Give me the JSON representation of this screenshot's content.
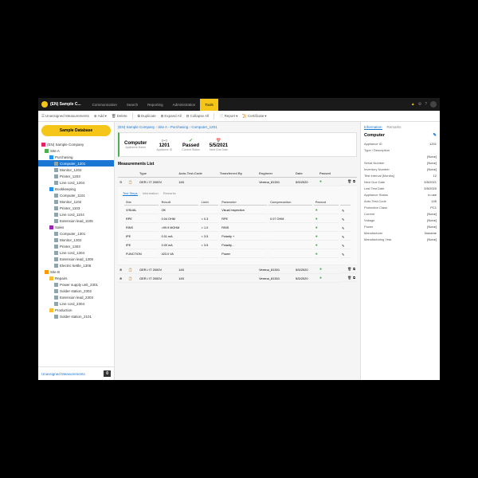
{
  "header": {
    "app_title": "(EN) Sample C...",
    "nav": [
      "Communication",
      "Search",
      "Reporting",
      "Administration",
      "Tools"
    ],
    "active_nav": 4
  },
  "toolbar": {
    "unassigned": "Unassigned Measurements",
    "add": "Add",
    "delete": "Delete",
    "duplicate": "Duplicate",
    "expand": "Expand All",
    "collapse": "Collapse All",
    "report": "Report",
    "certificate": "Certificate"
  },
  "sidebar": {
    "database_btn": "Sample Database",
    "tree": [
      {
        "lvl": 0,
        "ico": "company",
        "label": "(EN) Sample Company"
      },
      {
        "lvl": 1,
        "ico": "dept",
        "label": "Site A"
      },
      {
        "lvl": 2,
        "ico": "dept2",
        "label": "Purchasing"
      },
      {
        "lvl": 3,
        "ico": "device",
        "label": "Computer_1201",
        "sel": true
      },
      {
        "lvl": 3,
        "ico": "device",
        "label": "Monitor_1202"
      },
      {
        "lvl": 3,
        "ico": "device",
        "label": "Printer_1203"
      },
      {
        "lvl": 3,
        "ico": "device",
        "label": "Line cord_1204"
      },
      {
        "lvl": 2,
        "ico": "dept2",
        "label": "Bookkeeping"
      },
      {
        "lvl": 3,
        "ico": "device",
        "label": "Computer_1101"
      },
      {
        "lvl": 3,
        "ico": "device",
        "label": "Monitor_1102"
      },
      {
        "lvl": 3,
        "ico": "device",
        "label": "Printer_1103"
      },
      {
        "lvl": 3,
        "ico": "device",
        "label": "Line cord_1104"
      },
      {
        "lvl": 3,
        "ico": "device",
        "label": "Extension lead_1105"
      },
      {
        "lvl": 2,
        "ico": "dept3",
        "label": "Sales"
      },
      {
        "lvl": 3,
        "ico": "device",
        "label": "Computer_1301"
      },
      {
        "lvl": 3,
        "ico": "device",
        "label": "Monitor_1302"
      },
      {
        "lvl": 3,
        "ico": "device",
        "label": "Printer_1303"
      },
      {
        "lvl": 3,
        "ico": "device",
        "label": "Line cord_1304"
      },
      {
        "lvl": 3,
        "ico": "device",
        "label": "Extension lead_1305"
      },
      {
        "lvl": 3,
        "ico": "device",
        "label": "Electric kettle_1306"
      },
      {
        "lvl": 1,
        "ico": "dept4",
        "label": "Site B"
      },
      {
        "lvl": 2,
        "ico": "folder",
        "label": "Repairs"
      },
      {
        "lvl": 3,
        "ico": "device",
        "label": "Power supply unit_2301"
      },
      {
        "lvl": 3,
        "ico": "device",
        "label": "Solder station_2302"
      },
      {
        "lvl": 3,
        "ico": "device",
        "label": "Extension lead_2303"
      },
      {
        "lvl": 3,
        "ico": "device",
        "label": "Line cord_2304"
      },
      {
        "lvl": 2,
        "ico": "folder",
        "label": "Production"
      },
      {
        "lvl": 3,
        "ico": "device",
        "label": "Solder station_2101"
      }
    ],
    "footer_label": "Unassigned Measurements",
    "footer_count": "0"
  },
  "breadcrumb": [
    "(EN) Sample Company",
    "Site A",
    "Purchasing",
    "Computer_1201"
  ],
  "summary": {
    "name_label": "Computer",
    "name_sub": "Appliance Name",
    "id": "1201",
    "id_sub": "Appliance ID",
    "status": "Passed",
    "status_sub": "Current Status",
    "date": "5/5/2021",
    "date_sub": "Next Due Date"
  },
  "measurements": {
    "title": "Measurements List",
    "headers": [
      "Type",
      "Auto-Test-Code",
      "Transferred By",
      "Engineer",
      "Date",
      "Passed"
    ],
    "rows": [
      {
        "type": "GER./ IT 2000V",
        "code": "145",
        "eng": "Verena_81301",
        "date": "5/5/2020",
        "pass": true,
        "exp": true
      },
      {
        "type": "GER./ IT 2000V",
        "code": "145",
        "eng": "Verena_81301",
        "date": "5/5/2020",
        "pass": true
      },
      {
        "type": "GER./ IT 2000V",
        "code": "145",
        "eng": "Verena_81301",
        "date": "5/5/2020",
        "pass": true
      }
    ],
    "detail_tabs": [
      "Test Steps",
      "Information",
      "Remarks"
    ],
    "detail_headers": [
      "Site",
      "Result",
      "Limit",
      "Parameter",
      "Compensation",
      "Passed"
    ],
    "detail_rows": [
      {
        "site": "VISUAL",
        "result": "OK",
        "limit": "",
        "param": "Visual Inspection",
        "comp": "",
        "pass": true
      },
      {
        "site": "RPE",
        "result": "0.04 OHM",
        "limit": "< 0.3",
        "param": "RPE",
        "comp": "0.07 OHM",
        "pass": true
      },
      {
        "site": "RINS",
        "result": ">99.9 MOHM",
        "limit": "> 1.0",
        "param": "RINS",
        "comp": "",
        "pass": true
      },
      {
        "site": "IPE",
        "result": "0.01 mA",
        "limit": "< 3.5",
        "param": "Polarity +",
        "comp": "",
        "pass": true
      },
      {
        "site": "IPE",
        "result": "0.00 mA",
        "limit": "< 3.5",
        "param": "Polarity -",
        "comp": "",
        "pass": true
      },
      {
        "site": "FUNCTION",
        "result": "423.0 VA",
        "limit": "",
        "param": "Power",
        "comp": "",
        "pass": true
      }
    ]
  },
  "rightpanel": {
    "tabs": [
      "Information",
      "Remarks"
    ],
    "title": "Computer",
    "rows": [
      {
        "k": "Appliance ID",
        "v": "1201"
      },
      {
        "k": "Type / Description",
        "v": ""
      },
      {
        "k": "",
        "v": "[None]"
      },
      {
        "k": "Serial Number",
        "v": "[None]"
      },
      {
        "k": "Inventory Number",
        "v": "[None]"
      },
      {
        "k": "Test Interval [Months]",
        "v": "12"
      },
      {
        "k": "Next Due Date",
        "v": "5/5/2021"
      },
      {
        "k": "Last Test Date",
        "v": "5/5/2020"
      },
      {
        "k": "Appliance Status",
        "v": "in use"
      },
      {
        "k": "Auto-Test-Code",
        "v": "145"
      },
      {
        "k": "Protection Class",
        "v": "PC1"
      },
      {
        "k": "Current",
        "v": "[None]"
      },
      {
        "k": "Voltage",
        "v": "[None]"
      },
      {
        "k": "Power",
        "v": "[None]"
      },
      {
        "k": "Manufacturer",
        "v": "Noname"
      },
      {
        "k": "Manufacturing Year",
        "v": "[None]"
      }
    ]
  }
}
